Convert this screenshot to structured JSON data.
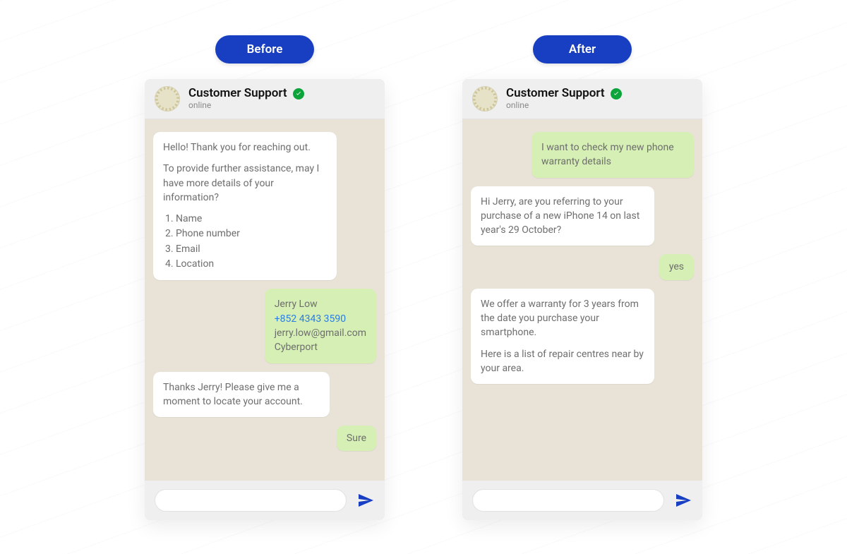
{
  "labels": {
    "before": "Before",
    "after": "After"
  },
  "colors": {
    "accent": "#183ec2",
    "user_bubble": "#d5efb4",
    "agent_bubble": "#ffffff",
    "chat_bg": "#e9e3d7",
    "verified": "#0da53b"
  },
  "left": {
    "header": {
      "title": "Customer Support",
      "status": "online"
    },
    "messages": {
      "m1_p1": "Hello! Thank you for reaching out.",
      "m1_p2": "To provide further assistance, may I have more details of your information?",
      "m1_list": {
        "i1": "Name",
        "i2": "Phone number",
        "i3": "Email",
        "i4": "Location"
      },
      "m2_line1": "Jerry Low",
      "m2_line2": "+852 4343 3590",
      "m2_line3": "jerry.low@gmail.com",
      "m2_line4": "Cyberport",
      "m3": "Thanks Jerry! Please give me a moment to locate your account.",
      "m4": "Sure"
    }
  },
  "right": {
    "header": {
      "title": "Customer Support",
      "status": "online"
    },
    "messages": {
      "m1": "I want to check my new phone warranty details",
      "m2": "Hi Jerry, are you referring to your purchase of a new iPhone 14 on last year's 29 October?",
      "m3": "yes",
      "m4_p1": "We offer a warranty for 3 years from the date you purchase your smartphone.",
      "m4_p2": "Here is a list of repair centres near by your area."
    }
  }
}
